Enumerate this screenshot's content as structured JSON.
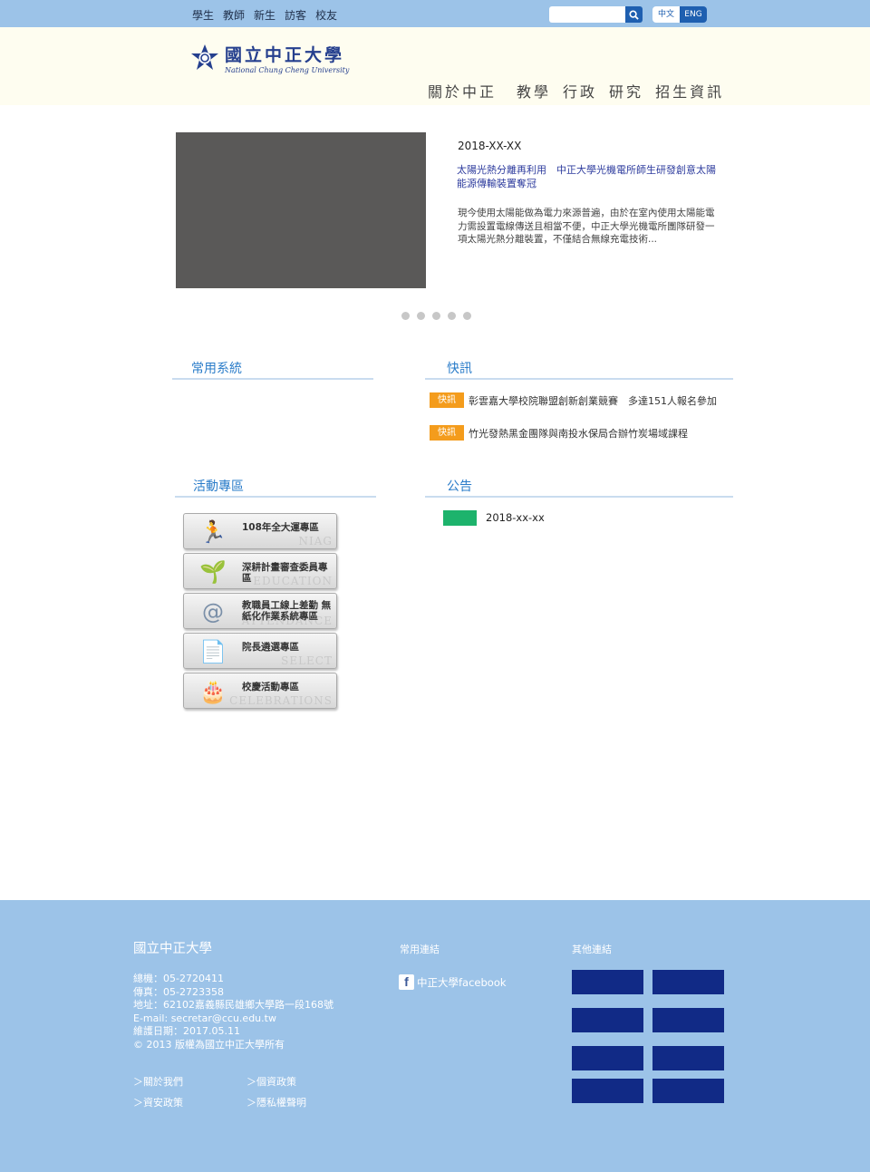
{
  "topbar": {
    "links": [
      "學生",
      "教師",
      "新生",
      "訪客",
      "校友"
    ],
    "lang_zh": "中文",
    "lang_en": "ENG"
  },
  "header": {
    "logo_cn": "國立中正大學",
    "logo_en": "National Chung Cheng University",
    "nav": [
      "關於中正",
      "教學",
      "行政",
      "研究",
      "招生資訊"
    ]
  },
  "slider": {
    "date": "2018-XX-XX",
    "title": "太陽光熱分離再利用　中正大學光機電所師生研發創意太陽能源傳輸裝置奪冠",
    "body": "現今使用太陽能做為電力來源普遍，由於在室內使用太陽能電力需設置電線傳送且相當不便，中正大學光機電所團隊研發一項太陽光熱分離裝置，不僅結合無線充電技術...",
    "dot_count": 5
  },
  "sections": {
    "systems": "常用系統",
    "news": "快訊",
    "activities": "活動專區",
    "notices": "公告"
  },
  "news": [
    {
      "badge": "快訊",
      "text": "彰雲嘉大學校院聯盟創新創業競賽　多達151人報名參加"
    },
    {
      "badge": "快訊",
      "text": "竹光發熱黑金團隊與南投水保局合辦竹炭場域課程"
    }
  ],
  "activities": [
    {
      "label": "108年全大運專區",
      "bg": "NIAG",
      "icon": "🏃"
    },
    {
      "label": "深耕計畫審查委員專區",
      "bg": "EDUCATION",
      "icon": "🌱"
    },
    {
      "label": "教職員工線上差勤 無紙化作業系統專區",
      "bg": "ATTENDANCE",
      "icon": "@"
    },
    {
      "label": "院長遴選專區",
      "bg": "SELECT",
      "icon": "📄"
    },
    {
      "label": "校慶活動專區",
      "bg": "CELEBRATIONS",
      "icon": "🎂"
    }
  ],
  "notices": [
    {
      "date": "2018-xx-xx",
      "color": "#1db36c"
    }
  ],
  "footer": {
    "name": "國立中正大學",
    "info": [
      "總機：05-2720411",
      "傳真：05-2723358",
      "地址：62102嘉義縣民雄鄉大學路一段168號",
      "E-mail: secretar@ccu.edu.tw",
      "維護日期：2017.05.11",
      "© 2013 版權為國立中正大學所有"
    ],
    "links": [
      "＞關於我們",
      "＞個資政策",
      "＞資安政策",
      "＞隱私權聲明"
    ],
    "common_links_title": "常用連結",
    "facebook": "中正大學facebook",
    "other_links_title": "其他連結",
    "other_link_count": 8,
    "block_color": "#112a86"
  },
  "colors": {
    "topbar": "#9cc3e8",
    "header_bg": "#fefdf0",
    "accent": "#2a7cc9",
    "badge": "#f49c1c"
  }
}
